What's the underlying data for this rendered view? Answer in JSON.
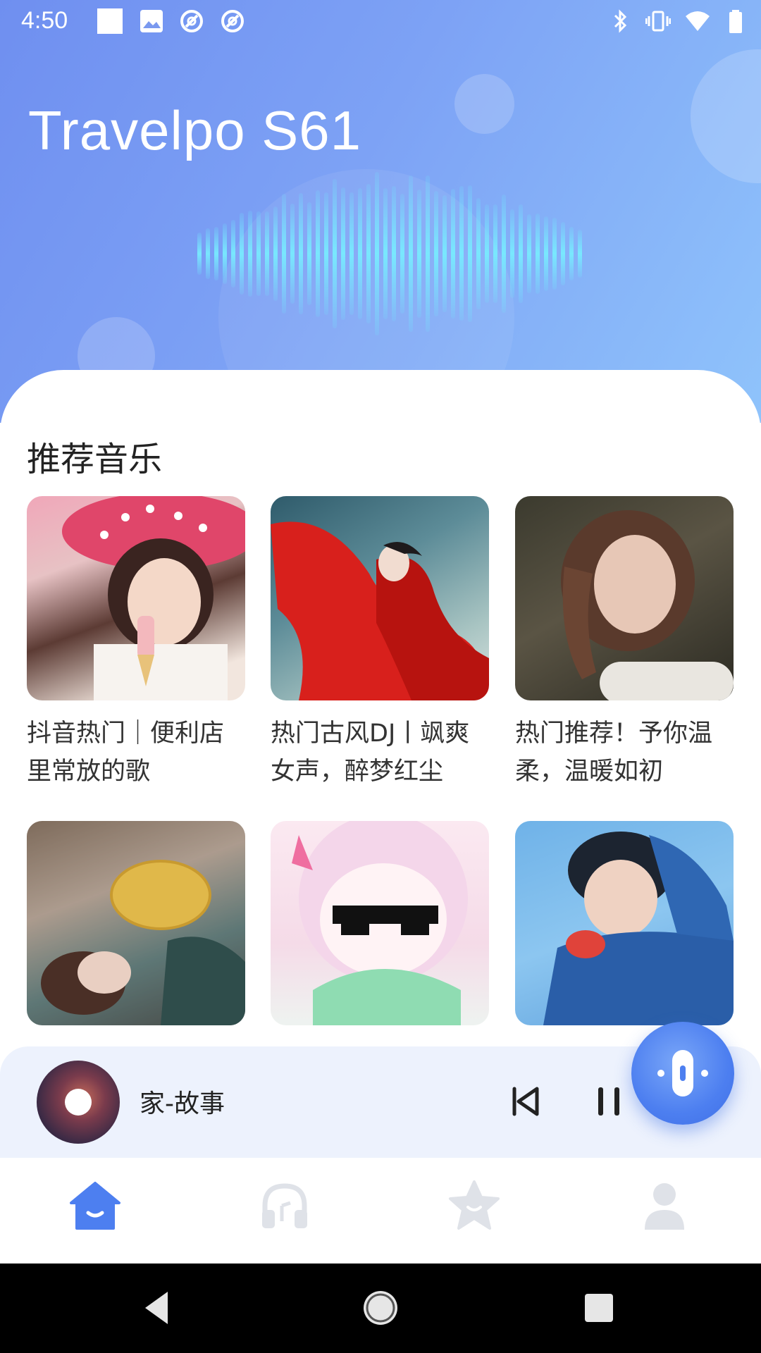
{
  "status_bar": {
    "time": "4:50",
    "icons_left": [
      "notification-square-icon",
      "image-icon",
      "sync-icon",
      "sync-icon"
    ],
    "icons_right": [
      "bluetooth-icon",
      "vibrate-icon",
      "wifi-icon",
      "battery-icon"
    ]
  },
  "header": {
    "title": "Travelpo S61"
  },
  "recommend": {
    "title": "推荐音乐",
    "items": [
      {
        "title": "抖音热门｜便利店里常放的歌",
        "accent": "#e24d6e"
      },
      {
        "title": "热门古风DJ丨飒爽女声，醉梦红尘",
        "accent": "#d4241f"
      },
      {
        "title": "热门推荐！予你温柔，温暖如初",
        "accent": "#6b5a4c"
      },
      {
        "title": "",
        "accent": "#8a6b52"
      },
      {
        "title": "",
        "accent": "#f1c6dc"
      },
      {
        "title": "",
        "accent": "#3a7fd0"
      }
    ]
  },
  "player": {
    "song": "家-故事",
    "prev_icon": "skip-previous-icon",
    "pause_icon": "pause-icon",
    "mic_icon": "microphone-icon"
  },
  "tabs": [
    {
      "name": "home",
      "icon": "home-icon",
      "active": true
    },
    {
      "name": "music",
      "icon": "headphones-icon",
      "active": false
    },
    {
      "name": "favorites",
      "icon": "star-icon",
      "active": false
    },
    {
      "name": "profile",
      "icon": "person-icon",
      "active": false
    }
  ],
  "colors": {
    "accent": "#4d7ff0",
    "tab_inactive": "#dfe2e8",
    "player_bg": "#edf2fd"
  }
}
